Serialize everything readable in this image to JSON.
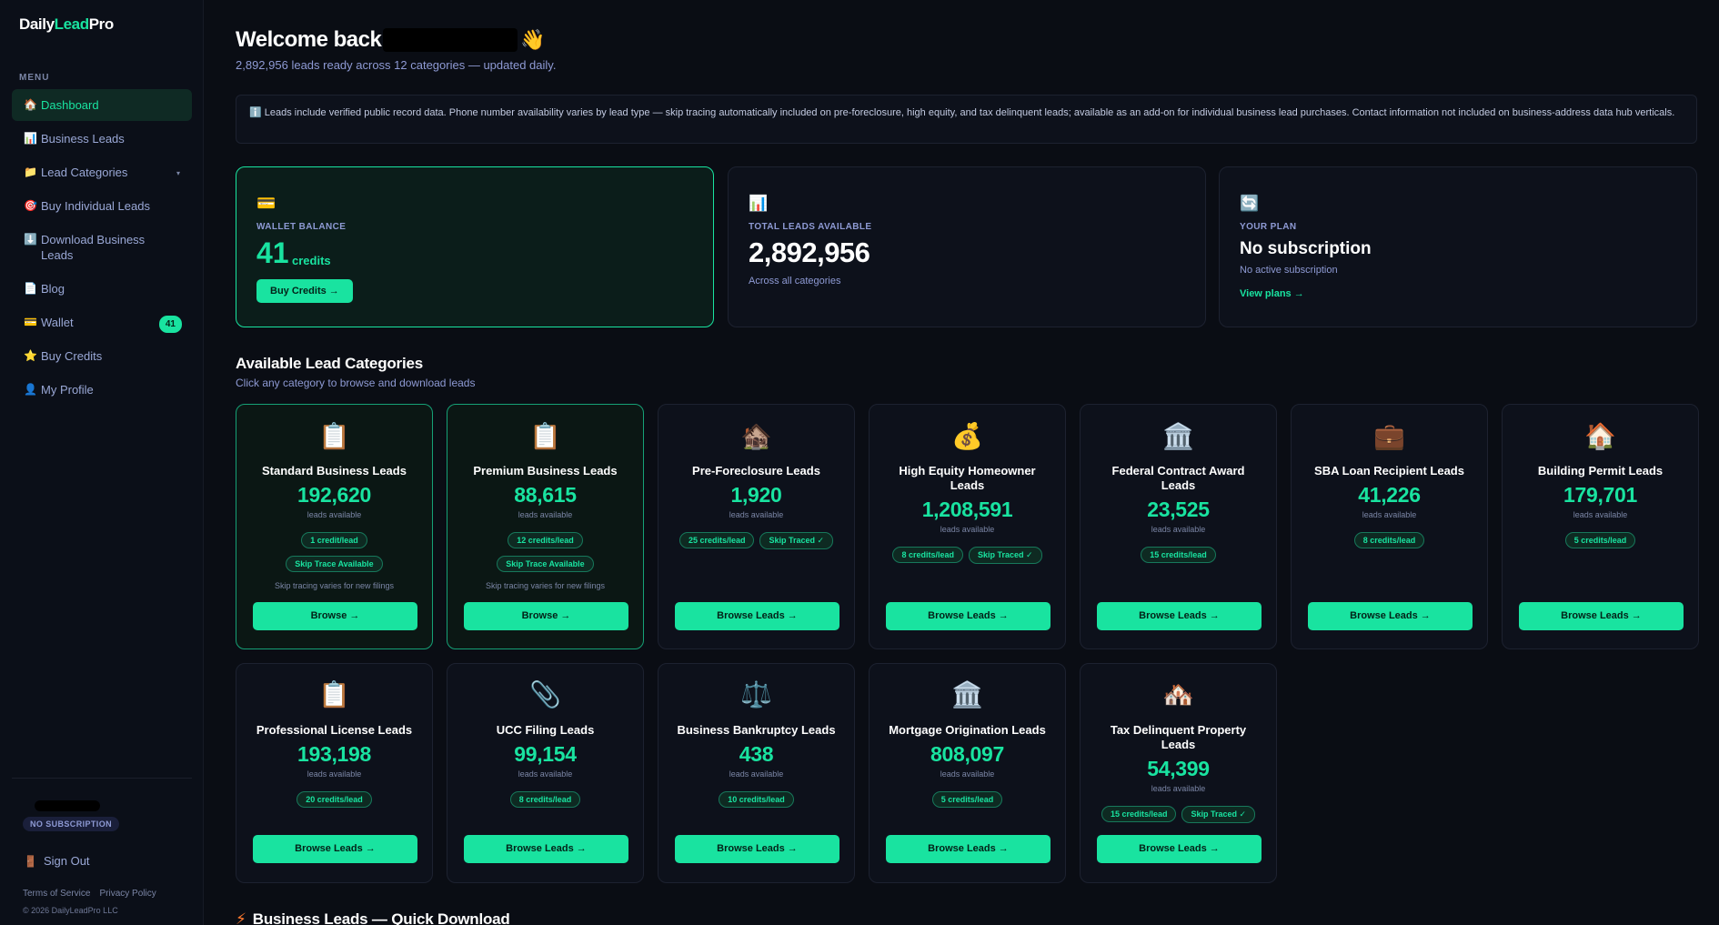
{
  "logo": {
    "prefix": "Daily",
    "accent": "Lead",
    "suffix": "Pro"
  },
  "menu": {
    "heading": "MENU",
    "items": [
      {
        "label": "Dashboard",
        "icon": "🏠",
        "active": true
      },
      {
        "label": "Business Leads",
        "icon": "📊"
      },
      {
        "label": "Lead Categories",
        "icon": "📁",
        "chevron": "▾"
      },
      {
        "label": "Buy Individual Leads",
        "icon": "🎯"
      },
      {
        "label": "Download Business Leads",
        "icon": "⬇️"
      },
      {
        "label": "Blog",
        "icon": "📄"
      },
      {
        "label": "Wallet",
        "icon": "💳",
        "badge": "41"
      },
      {
        "label": "Buy Credits",
        "icon": "⭐"
      },
      {
        "label": "My Profile",
        "icon": "👤"
      }
    ]
  },
  "sidebar_footer": {
    "plan_badge": "NO SUBSCRIPTION",
    "sign_out": "Sign Out",
    "sign_out_icon": "🚪",
    "terms": "Terms of Service",
    "privacy": "Privacy Policy",
    "copyright": "© 2026 DailyLeadPro LLC"
  },
  "header": {
    "welcome": "Welcome back",
    "wave_icon": "👋",
    "subline": "2,892,956 leads ready across 12 categories — updated daily."
  },
  "notice": {
    "icon": "ℹ️",
    "text": "Leads include verified public record data. Phone number availability varies by lead type — skip tracing automatically included on pre-foreclosure, high equity, and tax delinquent leads; available as an add-on for individual business lead purchases. Contact information not included on business-address data hub verticals."
  },
  "stats": {
    "wallet": {
      "icon": "💳",
      "label": "WALLET BALANCE",
      "value": "41",
      "unit": "credits",
      "button": "Buy Credits →"
    },
    "total": {
      "icon": "📊",
      "label": "TOTAL LEADS AVAILABLE",
      "value": "2,892,956",
      "sub": "Across all categories"
    },
    "plan": {
      "icon": "🔄",
      "label": "YOUR PLAN",
      "value": "No subscription",
      "sub": "No active subscription",
      "link": "View plans →"
    }
  },
  "categories_section": {
    "title": "Available Lead Categories",
    "subtitle": "Click any category to browse and download leads"
  },
  "cards": [
    {
      "icon": "📋",
      "name": "Standard Business Leads",
      "count": "192,620",
      "avail": "leads available",
      "pills": [
        "1 credit/lead"
      ],
      "pills2": [
        "Skip Trace Available"
      ],
      "note": "Skip tracing varies for new filings",
      "button": "Browse →",
      "featured": true
    },
    {
      "icon": "📋",
      "name": "Premium Business Leads",
      "count": "88,615",
      "avail": "leads available",
      "pills": [
        "12 credits/lead"
      ],
      "pills2": [
        "Skip Trace Available"
      ],
      "note": "Skip tracing varies for new filings",
      "button": "Browse →",
      "featured": true
    },
    {
      "icon": "🏚️",
      "name": "Pre-Foreclosure Leads",
      "count": "1,920",
      "avail": "leads available",
      "pills": [
        "25 credits/lead",
        "Skip Traced ✓"
      ],
      "button": "Browse Leads →"
    },
    {
      "icon": "💰",
      "name": "High Equity Homeowner Leads",
      "count": "1,208,591",
      "avail": "leads available",
      "pills": [
        "8 credits/lead",
        "Skip Traced ✓"
      ],
      "button": "Browse Leads →"
    },
    {
      "icon": "🏛️",
      "name": "Federal Contract Award Leads",
      "count": "23,525",
      "avail": "leads available",
      "pills": [
        "15 credits/lead"
      ],
      "button": "Browse Leads →"
    },
    {
      "icon": "💼",
      "name": "SBA Loan Recipient Leads",
      "count": "41,226",
      "avail": "leads available",
      "pills": [
        "8 credits/lead"
      ],
      "button": "Browse Leads →"
    },
    {
      "icon": "🏠",
      "name": "Building Permit Leads",
      "count": "179,701",
      "avail": "leads available",
      "pills": [
        "5 credits/lead"
      ],
      "button": "Browse Leads →"
    },
    {
      "icon": "📋",
      "name": "Professional License Leads",
      "count": "193,198",
      "avail": "leads available",
      "pills": [
        "20 credits/lead"
      ],
      "button": "Browse Leads →"
    },
    {
      "icon": "📎",
      "name": "UCC Filing Leads",
      "count": "99,154",
      "avail": "leads available",
      "pills": [
        "8 credits/lead"
      ],
      "button": "Browse Leads →"
    },
    {
      "icon": "⚖️",
      "name": "Business Bankruptcy Leads",
      "count": "438",
      "avail": "leads available",
      "pills": [
        "10 credits/lead"
      ],
      "button": "Browse Leads →"
    },
    {
      "icon": "🏛️",
      "name": "Mortgage Origination Leads",
      "count": "808,097",
      "avail": "leads available",
      "pills": [
        "5 credits/lead"
      ],
      "button": "Browse Leads →"
    },
    {
      "icon": "🏘️",
      "name": "Tax Delinquent Property Leads",
      "count": "54,399",
      "avail": "leads available",
      "pills": [
        "15 credits/lead",
        "Skip Traced ✓"
      ],
      "button": "Browse Leads →"
    }
  ],
  "bottom_section": {
    "icon": "⚡",
    "title": "Business Leads — Quick Download"
  }
}
